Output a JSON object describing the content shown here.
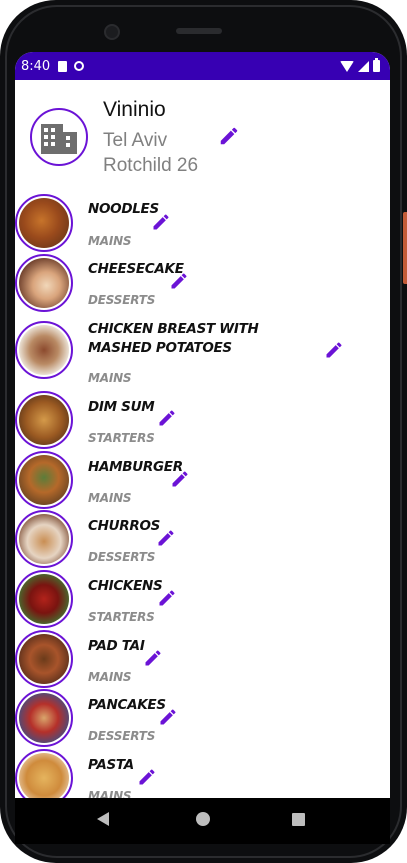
{
  "status_bar": {
    "time": "8:40",
    "bg_color": "#3700b3"
  },
  "header": {
    "name": "Vininio",
    "city": "Tel Aviv",
    "street": "Rotchild 26",
    "avatar_icon": "building-icon"
  },
  "accent_color": "#6b13d6",
  "dishes": [
    {
      "name": "Noodles",
      "category": "Mains"
    },
    {
      "name": "Cheesecake",
      "category": "Desserts"
    },
    {
      "name": "Chicken breast with mashed potatoes",
      "category": "Mains"
    },
    {
      "name": "Dim Sum",
      "category": "Starters"
    },
    {
      "name": "Hamburger",
      "category": "Mains"
    },
    {
      "name": "Churros",
      "category": "Desserts"
    },
    {
      "name": "Chickens",
      "category": "Starters"
    },
    {
      "name": "Pad Tai",
      "category": "Mains"
    },
    {
      "name": "Pancakes",
      "category": "Desserts"
    },
    {
      "name": "Pasta",
      "category": "Mains"
    }
  ]
}
